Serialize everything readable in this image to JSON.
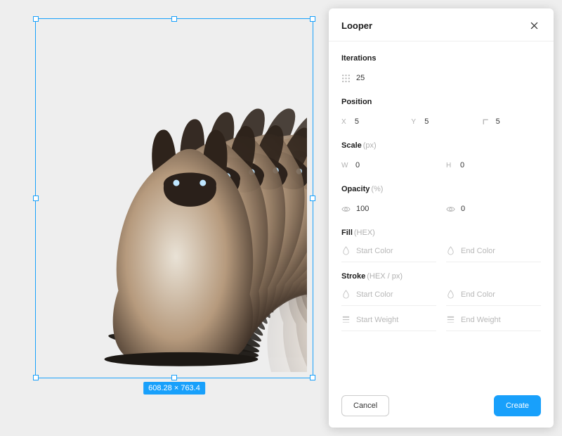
{
  "canvas": {
    "size_badge": "608.28 × 763.4"
  },
  "panel": {
    "title": "Looper",
    "sections": {
      "iterations": {
        "label": "Iterations",
        "value": "25"
      },
      "position": {
        "label": "Position",
        "x": "5",
        "y": "5",
        "rotation": "5"
      },
      "scale": {
        "label": "Scale",
        "unit": "(px)",
        "w": "0",
        "h": "0"
      },
      "opacity": {
        "label": "Opacity",
        "unit": "(%)",
        "start": "100",
        "end": "0"
      },
      "fill": {
        "label": "Fill",
        "unit": "(HEX)",
        "start_color_placeholder": "Start Color",
        "end_color_placeholder": "End Color"
      },
      "stroke": {
        "label": "Stroke",
        "unit": "(HEX / px)",
        "start_color_placeholder": "Start Color",
        "end_color_placeholder": "End Color",
        "start_weight_placeholder": "Start Weight",
        "end_weight_placeholder": "End Weight"
      }
    },
    "buttons": {
      "cancel": "Cancel",
      "create": "Create"
    }
  }
}
